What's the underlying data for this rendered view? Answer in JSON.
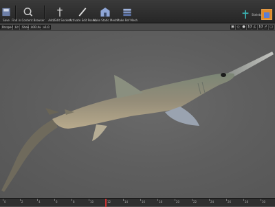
{
  "toolbar": {
    "buttons": [
      {
        "label": "Save",
        "icon": "save-icon"
      },
      {
        "label": "Find in Content Browser",
        "icon": "find-in-browser-icon"
      },
      {
        "label": "Add/Edit Sockets",
        "icon": "socket-icon"
      },
      {
        "label": "Activate Edit Poses",
        "icon": "edit-pose-icon"
      },
      {
        "label": "Make Static Mesh",
        "icon": "static-mesh-icon"
      },
      {
        "label": "Make Ref Mesh",
        "icon": "ref-mesh-icon"
      }
    ],
    "right_label": "Skeleton",
    "accent_color": "#e08a2a"
  },
  "viewport_bar": {
    "perspective_label": "Perspective",
    "lit_label": "Lit",
    "show_label": "Show",
    "lod_label": "LOD Auto",
    "speed_label": "x1.0",
    "mini_buttons": [
      "▣",
      "◇",
      "●",
      "10",
      "∠",
      "10",
      "↗",
      "▢"
    ]
  },
  "timeline": {
    "ticks": [
      "0",
      "2",
      "4",
      "6",
      "8",
      "10",
      "12",
      "14",
      "16",
      "18",
      "20",
      "22",
      "24",
      "26",
      "28",
      "30"
    ],
    "playhead_frame": 12
  }
}
